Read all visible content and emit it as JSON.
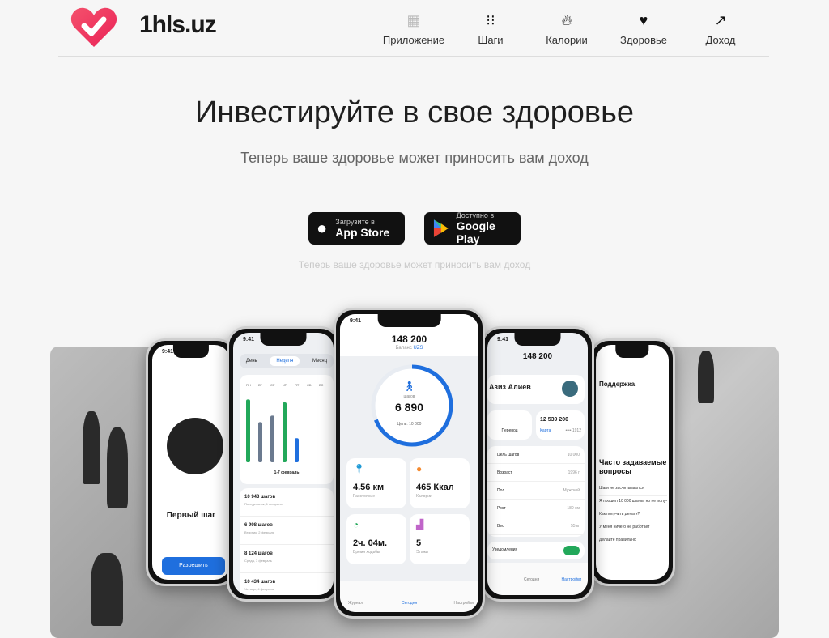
{
  "header": {
    "brand": "1hls.uz",
    "nav": [
      {
        "label": "Приложение",
        "icon": "apps-icon"
      },
      {
        "label": "Шаги",
        "icon": "footprints-icon"
      },
      {
        "label": "Калории",
        "icon": "flame-icon"
      },
      {
        "label": "Здоровье",
        "icon": "heart-icon"
      },
      {
        "label": "Доход",
        "icon": "trending-up-icon"
      }
    ]
  },
  "hero": {
    "title": "Инвестируйте в свое здоровье",
    "subtitle": "Теперь ваше здоровье может приносить вам доход",
    "note": "Теперь ваше здоровье может приносить вам доход"
  },
  "stores": {
    "appstore": {
      "small": "Загрузите в",
      "big": "App Store"
    },
    "googleplay": {
      "small": "Доступно в",
      "big": "Google Play"
    }
  },
  "colors": {
    "brand": "#f0365a",
    "accent": "#1f6fde",
    "green": "#22a85a"
  },
  "center_phone": {
    "time": "9:41",
    "balance": "148 200",
    "balance_label": "Баланс",
    "currency": "UZS",
    "steps_label": "шагов",
    "steps": "6 890",
    "goal": "Цель: 10 000",
    "progress": 0.689,
    "tiles": [
      {
        "value": "4.56 км",
        "label": "Расстояние"
      },
      {
        "value": "465 Ккал",
        "label": "Калории"
      },
      {
        "value": "2ч. 04м.",
        "label": "Время ходьбы"
      },
      {
        "value": "5",
        "label": "Этажи"
      }
    ],
    "tabs": [
      "Журнал",
      "Сегодня",
      "Настройки"
    ]
  },
  "left_phone": {
    "time": "9:41",
    "segments": [
      "День",
      "Неделя",
      "Месяц"
    ],
    "days": [
      "ПН",
      "ВТ",
      "СР",
      "ЧТ",
      "ПТ",
      "СБ",
      "ВС"
    ],
    "bar_values": [
      10943,
      6998,
      8124,
      10434,
      4200
    ],
    "range": "1-7 февраль",
    "entries": [
      {
        "steps": "10 943 шагов",
        "date": "Понедельник, 1 февраль"
      },
      {
        "steps": "6 998 шагов",
        "date": "Вторник, 2 февраль"
      },
      {
        "steps": "8 124 шагов",
        "date": "Среда, 3 февраль"
      },
      {
        "steps": "10 434 шагов",
        "date": "Четверг, 4 февраль"
      }
    ]
  },
  "far_left_phone": {
    "time": "9:41",
    "title": "Первый шаг",
    "button": "Разрешить"
  },
  "right_phone": {
    "time": "9:41",
    "balance": "148 200",
    "name": "Азиз Алиев",
    "transfer": "Перевод",
    "card_amount": "12 539 200",
    "card_label": "Карта",
    "card_mask": "•••• 1912",
    "rows": [
      {
        "label": "Цель шагов",
        "value": "10 000"
      },
      {
        "label": "Возраст",
        "value": "1996 г"
      },
      {
        "label": "Пол",
        "value": "Мужской"
      },
      {
        "label": "Рост",
        "value": "180 см"
      },
      {
        "label": "Вес",
        "value": "55 кг"
      }
    ],
    "notifications": "Уведомления",
    "tab_settings": "Настройки",
    "tab_today": "Сегодня"
  },
  "far_right_phone": {
    "title": "Поддержка",
    "faq_title": "Часто задаваемые вопросы",
    "items": [
      "Шаги не засчитываются",
      "Я прошел 10 000 шагов, но не получил",
      "Как получить деньги?",
      "У меня ничего не работает",
      "Делайте правильно"
    ]
  }
}
